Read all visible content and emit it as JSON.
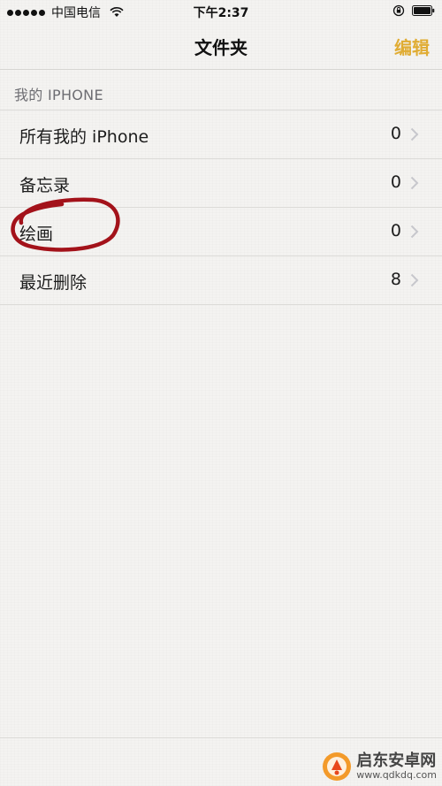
{
  "status_bar": {
    "carrier": "中国电信",
    "time": "下午2:37"
  },
  "nav": {
    "title": "文件夹",
    "edit_label": "编辑"
  },
  "section": {
    "header": "我的 IPHONE"
  },
  "folders": [
    {
      "name": "所有我的 iPhone",
      "count": "0"
    },
    {
      "name": "备忘录",
      "count": "0"
    },
    {
      "name": "绘画",
      "count": "0"
    },
    {
      "name": "最近删除",
      "count": "8"
    }
  ],
  "colors": {
    "accent": "#e0ac33",
    "background": "#f4f3f1",
    "annotation": "#a3121a"
  },
  "watermark": {
    "name": "启东安卓网",
    "url": "www.qdkdq.com"
  }
}
